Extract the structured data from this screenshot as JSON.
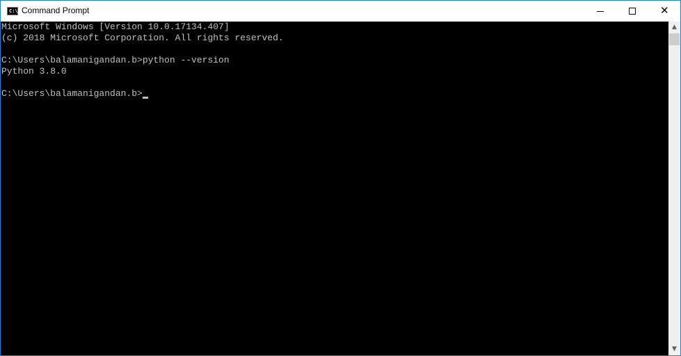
{
  "window": {
    "title": "Command Prompt",
    "icon": "cmd-icon",
    "icon_text": "C:\\_",
    "controls": {
      "minimize": "minimize-icon",
      "maximize": "maximize-icon",
      "close": "close-icon",
      "close_glyph": "✕"
    }
  },
  "console": {
    "lines": [
      "Microsoft Windows [Version 10.0.17134.407]",
      "(c) 2018 Microsoft Corporation. All rights reserved.",
      "",
      "C:\\Users\\balamanigandan.b>python --version",
      "Python 3.8.0",
      "",
      "C:\\Users\\balamanigandan.b>"
    ],
    "colors": {
      "background": "#000000",
      "foreground": "#c0c0c0"
    }
  },
  "scrollbar": {
    "up": "▲",
    "down": "▼"
  }
}
